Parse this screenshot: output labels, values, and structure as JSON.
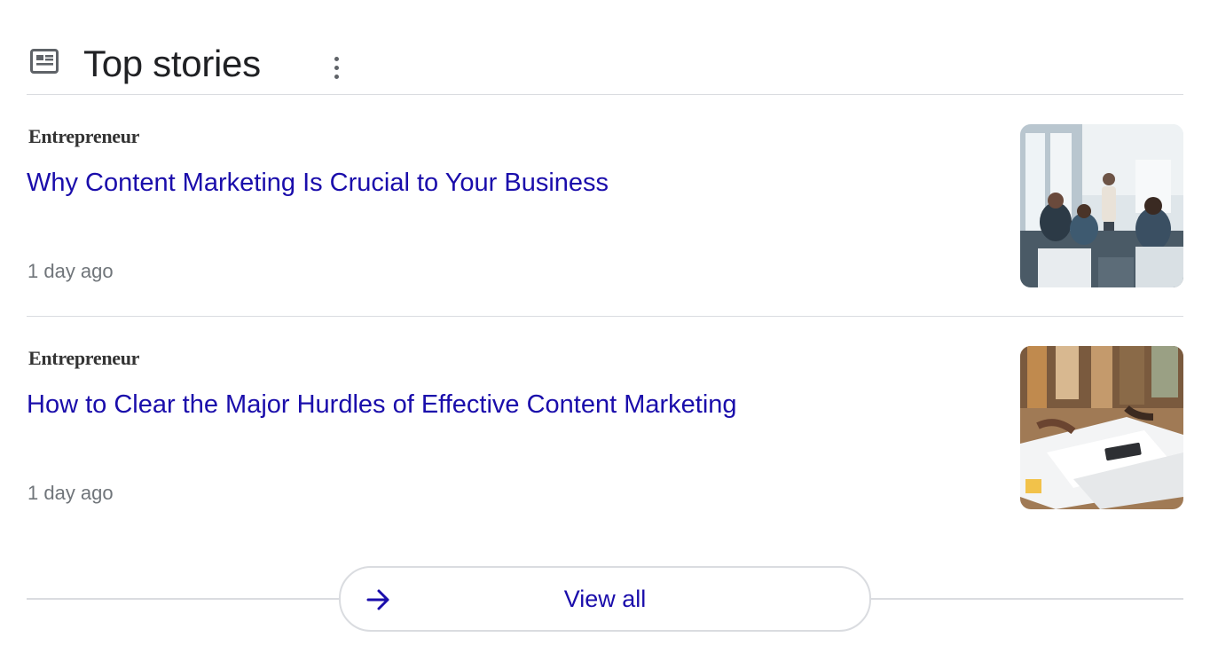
{
  "header": {
    "icon": "news-icon",
    "title": "Top stories",
    "menu_icon": "more-vert-icon"
  },
  "stories": [
    {
      "source": "Entrepreneur",
      "headline": "Why Content Marketing Is Crucial to Your Business",
      "time": "1 day ago",
      "thumbnail": "photo-meeting-presentation"
    },
    {
      "source": "Entrepreneur",
      "headline": "How to Clear the Major Hurdles of Effective Content Marketing",
      "time": "1 day ago",
      "thumbnail": "photo-team-papers-on-table"
    }
  ],
  "footer": {
    "view_all_label": "View all",
    "view_all_icon": "arrow-right-icon"
  },
  "colors": {
    "link": "#1a0dab",
    "title": "#202124",
    "meta": "#70757a",
    "divider": "#dadce0",
    "icon": "#5f6368"
  }
}
